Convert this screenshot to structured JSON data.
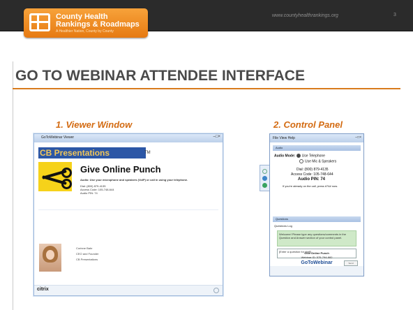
{
  "header": {
    "logo_line1": "County Health",
    "logo_line2": "Rankings & Roadmaps",
    "logo_tagline": "A Healthier Nation, County by County",
    "url": "www.countyhealthrankings.org",
    "page_number": "3"
  },
  "slide": {
    "title": "GO TO WEBINAR ATTENDEE INTERFACE",
    "caption_viewer": "1. Viewer Window",
    "caption_control": "2. Control Panel"
  },
  "viewer": {
    "titlebar": "GoToWebinar Viewer",
    "banner": "CB Presentations",
    "trademark": "TM",
    "event_title": "Give Online Punch",
    "audio_note": "Audio: Use your microphone and speakers (VoIP) or call in using your telephone.",
    "dial": "Dial: (800) 879-4135",
    "access": "Access Code: 105-748-644",
    "pin": "Audio PIN: 74",
    "presenter_name": "Corinne Bahr",
    "presenter_role": "CEO and Founder",
    "presenter_org": "CB Presentations",
    "brand": "citrix"
  },
  "control": {
    "menu": "File   View   Help",
    "audio_header": "Audio",
    "audio_mode_label": "Audio Mode:",
    "opt_phone": "Use Telephone",
    "opt_mic": "Use Mic & Speakers",
    "dial": "Dial: (800) 879-4135",
    "access": "Access Code: 105-748-644",
    "pin": "Audio PIN: 74",
    "already": "If you're already on the call, press #74# now.",
    "questions_header": "Questions",
    "questions_log": "Questions Log",
    "welcome": "Welcome! Please type any questions/comments in the Question and Answer section of your control panel.",
    "placeholder": "[Enter a question for staff]",
    "send": "Send",
    "event": "Give Online Punch",
    "webinar_id": "Webinar ID: 575-794-882",
    "logo": "GoToWebinar"
  }
}
